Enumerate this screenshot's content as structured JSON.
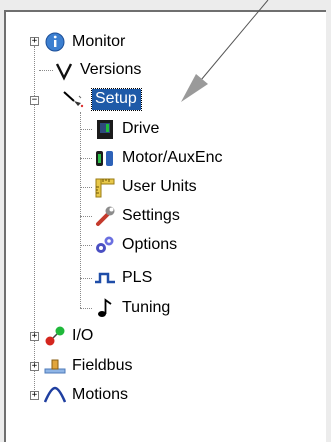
{
  "tree": {
    "monitor": "Monitor",
    "versions": "Versions",
    "setup": "Setup",
    "setup_children": [
      "Drive",
      "Motor/AuxEnc",
      "User Units",
      "Settings",
      "Options",
      "PLS",
      "Tuning"
    ],
    "io": "I/O",
    "fieldbus": "Fieldbus",
    "motions": "Motions",
    "selected": "Setup"
  },
  "colors": {
    "selection": "#1e5aa8"
  },
  "icons": {
    "monitor": "info-icon",
    "versions": "v-icon",
    "setup": "probe-icon",
    "drive": "drive-icon",
    "motor": "motor-icon",
    "user_units": "ruler-icon",
    "settings": "wrench-icon",
    "options": "gears-icon",
    "pls": "pulse-icon",
    "tuning": "note-icon",
    "io": "io-icon",
    "fieldbus": "fieldbus-icon",
    "motions": "motion-curve-icon"
  }
}
